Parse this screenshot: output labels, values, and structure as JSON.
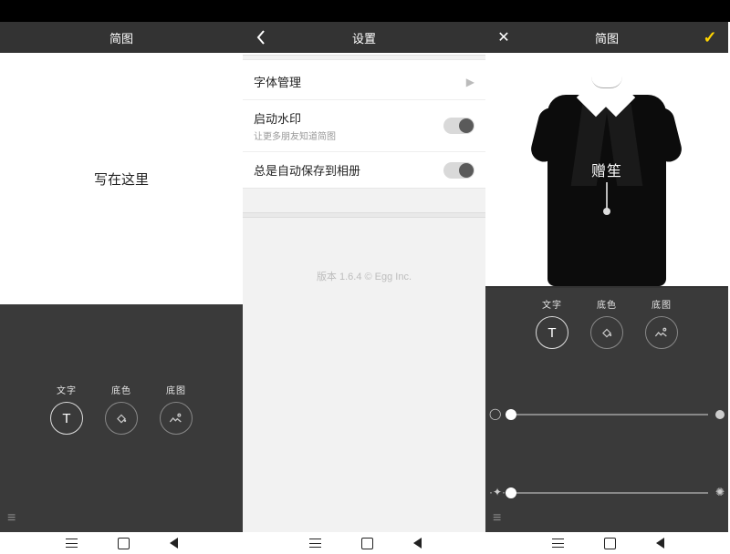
{
  "phone1": {
    "title": "简图",
    "canvas_text": "写在这里",
    "tools": {
      "text": "文字",
      "fill": "底色",
      "image": "底图"
    }
  },
  "phone2": {
    "title": "设置",
    "rows": {
      "fonts": "字体管理",
      "watermark": "启动水印",
      "watermark_sub": "让更多朋友知道简图",
      "autosave": "总是自动保存到相册"
    },
    "version_line": "版本 1.6.4    © Egg Inc."
  },
  "phone3": {
    "title": "简图",
    "canvas_text": "赠笙",
    "tools": {
      "text": "文字",
      "fill": "底色",
      "image": "底图"
    }
  }
}
